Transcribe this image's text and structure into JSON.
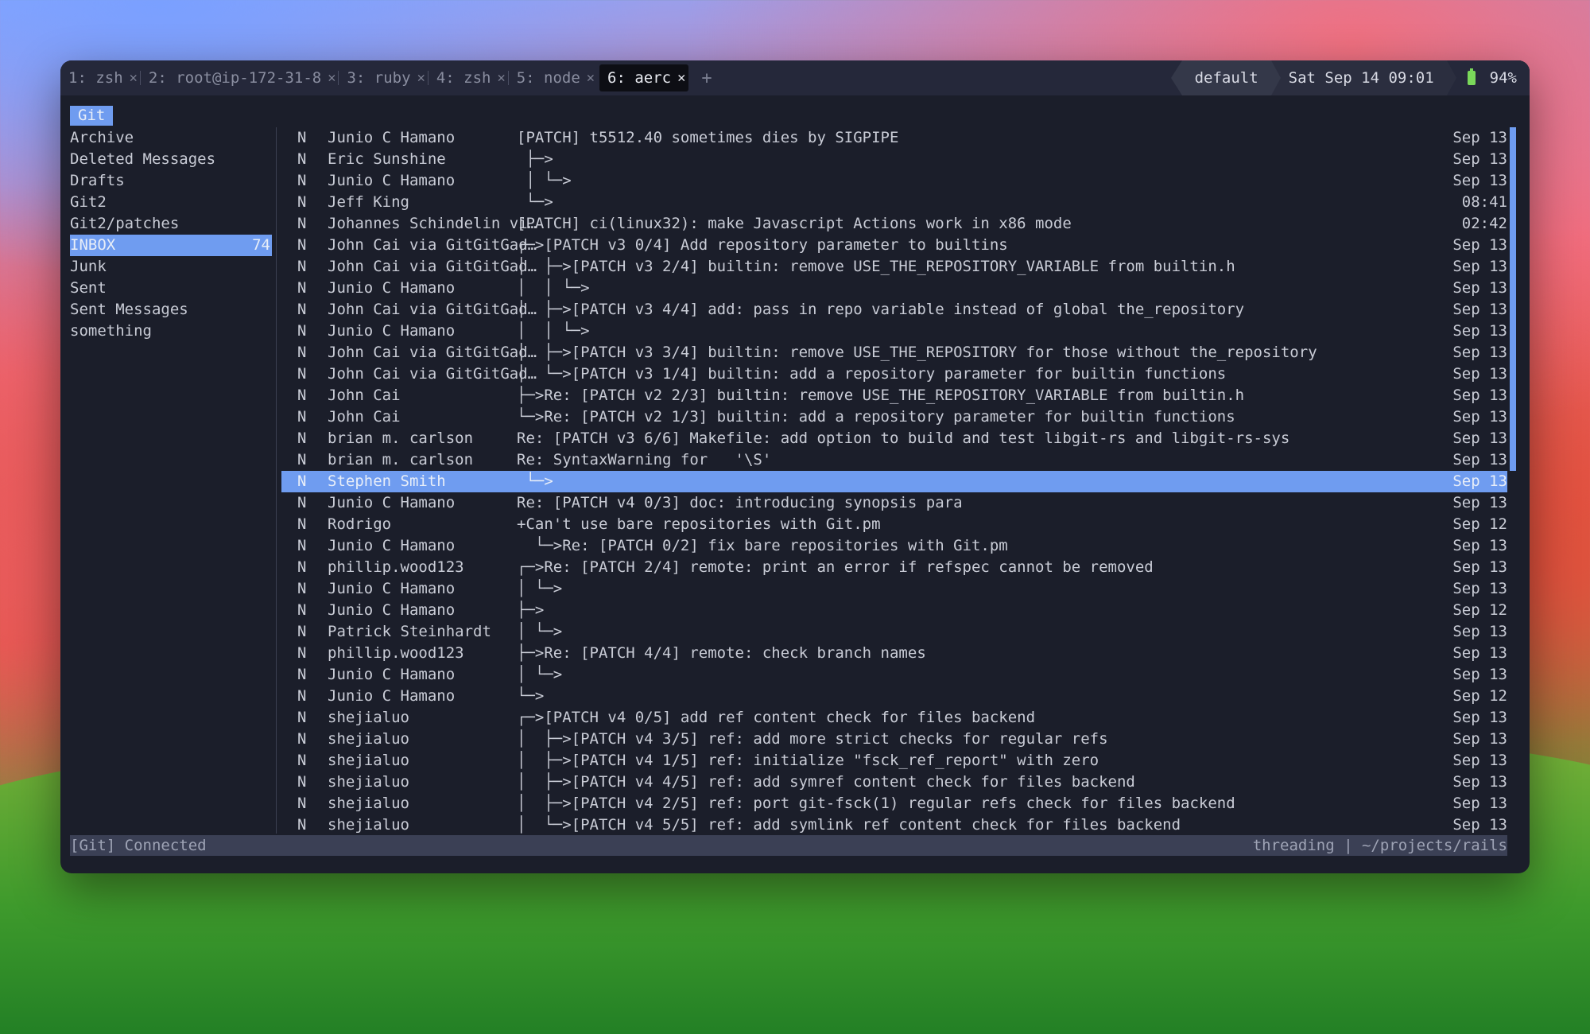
{
  "tabs": [
    {
      "label": "1: zsh",
      "active": false
    },
    {
      "label": "2: root@ip-172-31-8",
      "active": false
    },
    {
      "label": "3: ruby",
      "active": false
    },
    {
      "label": "4: zsh",
      "active": false
    },
    {
      "label": "5: node",
      "active": false
    },
    {
      "label": "6: aerc",
      "active": true
    }
  ],
  "tab_close_glyph": "✕",
  "tab_add_glyph": "+",
  "status": {
    "session": "default",
    "datetime": "Sat Sep 14 09:01",
    "battery": "94%"
  },
  "account_tab": "Git",
  "folders": [
    {
      "name": "Archive",
      "count": ""
    },
    {
      "name": "Deleted Messages",
      "count": ""
    },
    {
      "name": "Drafts",
      "count": ""
    },
    {
      "name": "Git2",
      "count": ""
    },
    {
      "name": "Git2/patches",
      "count": ""
    },
    {
      "name": "INBOX",
      "count": "74",
      "selected": true
    },
    {
      "name": "Junk",
      "count": ""
    },
    {
      "name": "Sent",
      "count": ""
    },
    {
      "name": "Sent Messages",
      "count": ""
    },
    {
      "name": "something",
      "count": ""
    }
  ],
  "messages": [
    {
      "flag": "N",
      "from": "Junio C Hamano",
      "subject": "[PATCH] t5512.40 sometimes dies by SIGPIPE",
      "date": "Sep 13"
    },
    {
      "flag": "N",
      "from": "Eric Sunshine",
      "subject": " ├─>",
      "date": "Sep 13"
    },
    {
      "flag": "N",
      "from": "Junio C Hamano",
      "subject": " │ └─>",
      "date": "Sep 13"
    },
    {
      "flag": "N",
      "from": "Jeff King",
      "subject": " └─>",
      "date": "08:41"
    },
    {
      "flag": "N",
      "from": "Johannes Schindelin vi…",
      "subject": "[PATCH] ci(linux32): make Javascript Actions work in x86 mode",
      "date": "02:42"
    },
    {
      "flag": "N",
      "from": "John Cai via GitGitGad…",
      "subject": "┌─>[PATCH v3 0/4] Add repository parameter to builtins",
      "date": "Sep 13"
    },
    {
      "flag": "N",
      "from": "John Cai via GitGitGad…",
      "subject": "│  ├─>[PATCH v3 2/4] builtin: remove USE_THE_REPOSITORY_VARIABLE from builtin.h",
      "date": "Sep 13"
    },
    {
      "flag": "N",
      "from": "Junio C Hamano",
      "subject": "│  │ └─>",
      "date": "Sep 13"
    },
    {
      "flag": "N",
      "from": "John Cai via GitGitGad…",
      "subject": "│  ├─>[PATCH v3 4/4] add: pass in repo variable instead of global the_repository",
      "date": "Sep 13"
    },
    {
      "flag": "N",
      "from": "Junio C Hamano",
      "subject": "│  │ └─>",
      "date": "Sep 13"
    },
    {
      "flag": "N",
      "from": "John Cai via GitGitGad…",
      "subject": "│  ├─>[PATCH v3 3/4] builtin: remove USE_THE_REPOSITORY for those without the_repository",
      "date": "Sep 13"
    },
    {
      "flag": "N",
      "from": "John Cai via GitGitGad…",
      "subject": "│  └─>[PATCH v3 1/4] builtin: add a repository parameter for builtin functions",
      "date": "Sep 13"
    },
    {
      "flag": "N",
      "from": "John Cai",
      "subject": "├─>Re: [PATCH v2 2/3] builtin: remove USE_THE_REPOSITORY_VARIABLE from builtin.h",
      "date": "Sep 13"
    },
    {
      "flag": "N",
      "from": "John Cai",
      "subject": "└─>Re: [PATCH v2 1/3] builtin: add a repository parameter for builtin functions",
      "date": "Sep 13"
    },
    {
      "flag": "N",
      "from": "brian m. carlson",
      "subject": "Re: [PATCH v3 6/6] Makefile: add option to build and test libgit-rs and libgit-rs-sys",
      "date": "Sep 13"
    },
    {
      "flag": "N",
      "from": "brian m. carlson",
      "subject": "Re: SyntaxWarning for   '\\S'",
      "date": "Sep 13"
    },
    {
      "flag": "N",
      "from": "Stephen Smith",
      "subject": " └─>",
      "date": "Sep 13",
      "selected": true
    },
    {
      "flag": "N",
      "from": "Junio C Hamano",
      "subject": "Re: [PATCH v4 0/3] doc: introducing synopsis para",
      "date": "Sep 13"
    },
    {
      "flag": "N",
      "from": "Rodrigo",
      "subject": "+Can't use bare repositories with Git.pm",
      "date": "Sep 12"
    },
    {
      "flag": "N",
      "from": "Junio C Hamano",
      "subject": "  └─>Re: [PATCH 0/2] fix bare repositories with Git.pm",
      "date": "Sep 13"
    },
    {
      "flag": "N",
      "from": "phillip.wood123",
      "subject": "┌─>Re: [PATCH 2/4] remote: print an error if refspec cannot be removed",
      "date": "Sep 13"
    },
    {
      "flag": "N",
      "from": "Junio C Hamano",
      "subject": "│ └─>",
      "date": "Sep 13"
    },
    {
      "flag": "N",
      "from": "Junio C Hamano",
      "subject": "├─>",
      "date": "Sep 12"
    },
    {
      "flag": "N",
      "from": "Patrick Steinhardt",
      "subject": "│ └─>",
      "date": "Sep 13"
    },
    {
      "flag": "N",
      "from": "phillip.wood123",
      "subject": "├─>Re: [PATCH 4/4] remote: check branch names",
      "date": "Sep 13"
    },
    {
      "flag": "N",
      "from": "Junio C Hamano",
      "subject": "│ └─>",
      "date": "Sep 13"
    },
    {
      "flag": "N",
      "from": "Junio C Hamano",
      "subject": "└─>",
      "date": "Sep 12"
    },
    {
      "flag": "N",
      "from": "shejialuo",
      "subject": "┌─>[PATCH v4 0/5] add ref content check for files backend",
      "date": "Sep 13"
    },
    {
      "flag": "N",
      "from": "shejialuo",
      "subject": "│  ├─>[PATCH v4 3/5] ref: add more strict checks for regular refs",
      "date": "Sep 13"
    },
    {
      "flag": "N",
      "from": "shejialuo",
      "subject": "│  ├─>[PATCH v4 1/5] ref: initialize \"fsck_ref_report\" with zero",
      "date": "Sep 13"
    },
    {
      "flag": "N",
      "from": "shejialuo",
      "subject": "│  ├─>[PATCH v4 4/5] ref: add symref content check for files backend",
      "date": "Sep 13"
    },
    {
      "flag": "N",
      "from": "shejialuo",
      "subject": "│  ├─>[PATCH v4 2/5] ref: port git-fsck(1) regular refs check for files backend",
      "date": "Sep 13"
    },
    {
      "flag": "N",
      "from": "shejialuo",
      "subject": "│  └─>[PATCH v4 5/5] ref: add symlink ref content check for files backend",
      "date": "Sep 13"
    }
  ],
  "statusbar": {
    "left": "[Git] Connected",
    "right": "threading | ~/projects/rails"
  },
  "colors": {
    "accent": "#6f9cf0",
    "background": "#1b1e2a",
    "battery": "#7ad85a"
  }
}
